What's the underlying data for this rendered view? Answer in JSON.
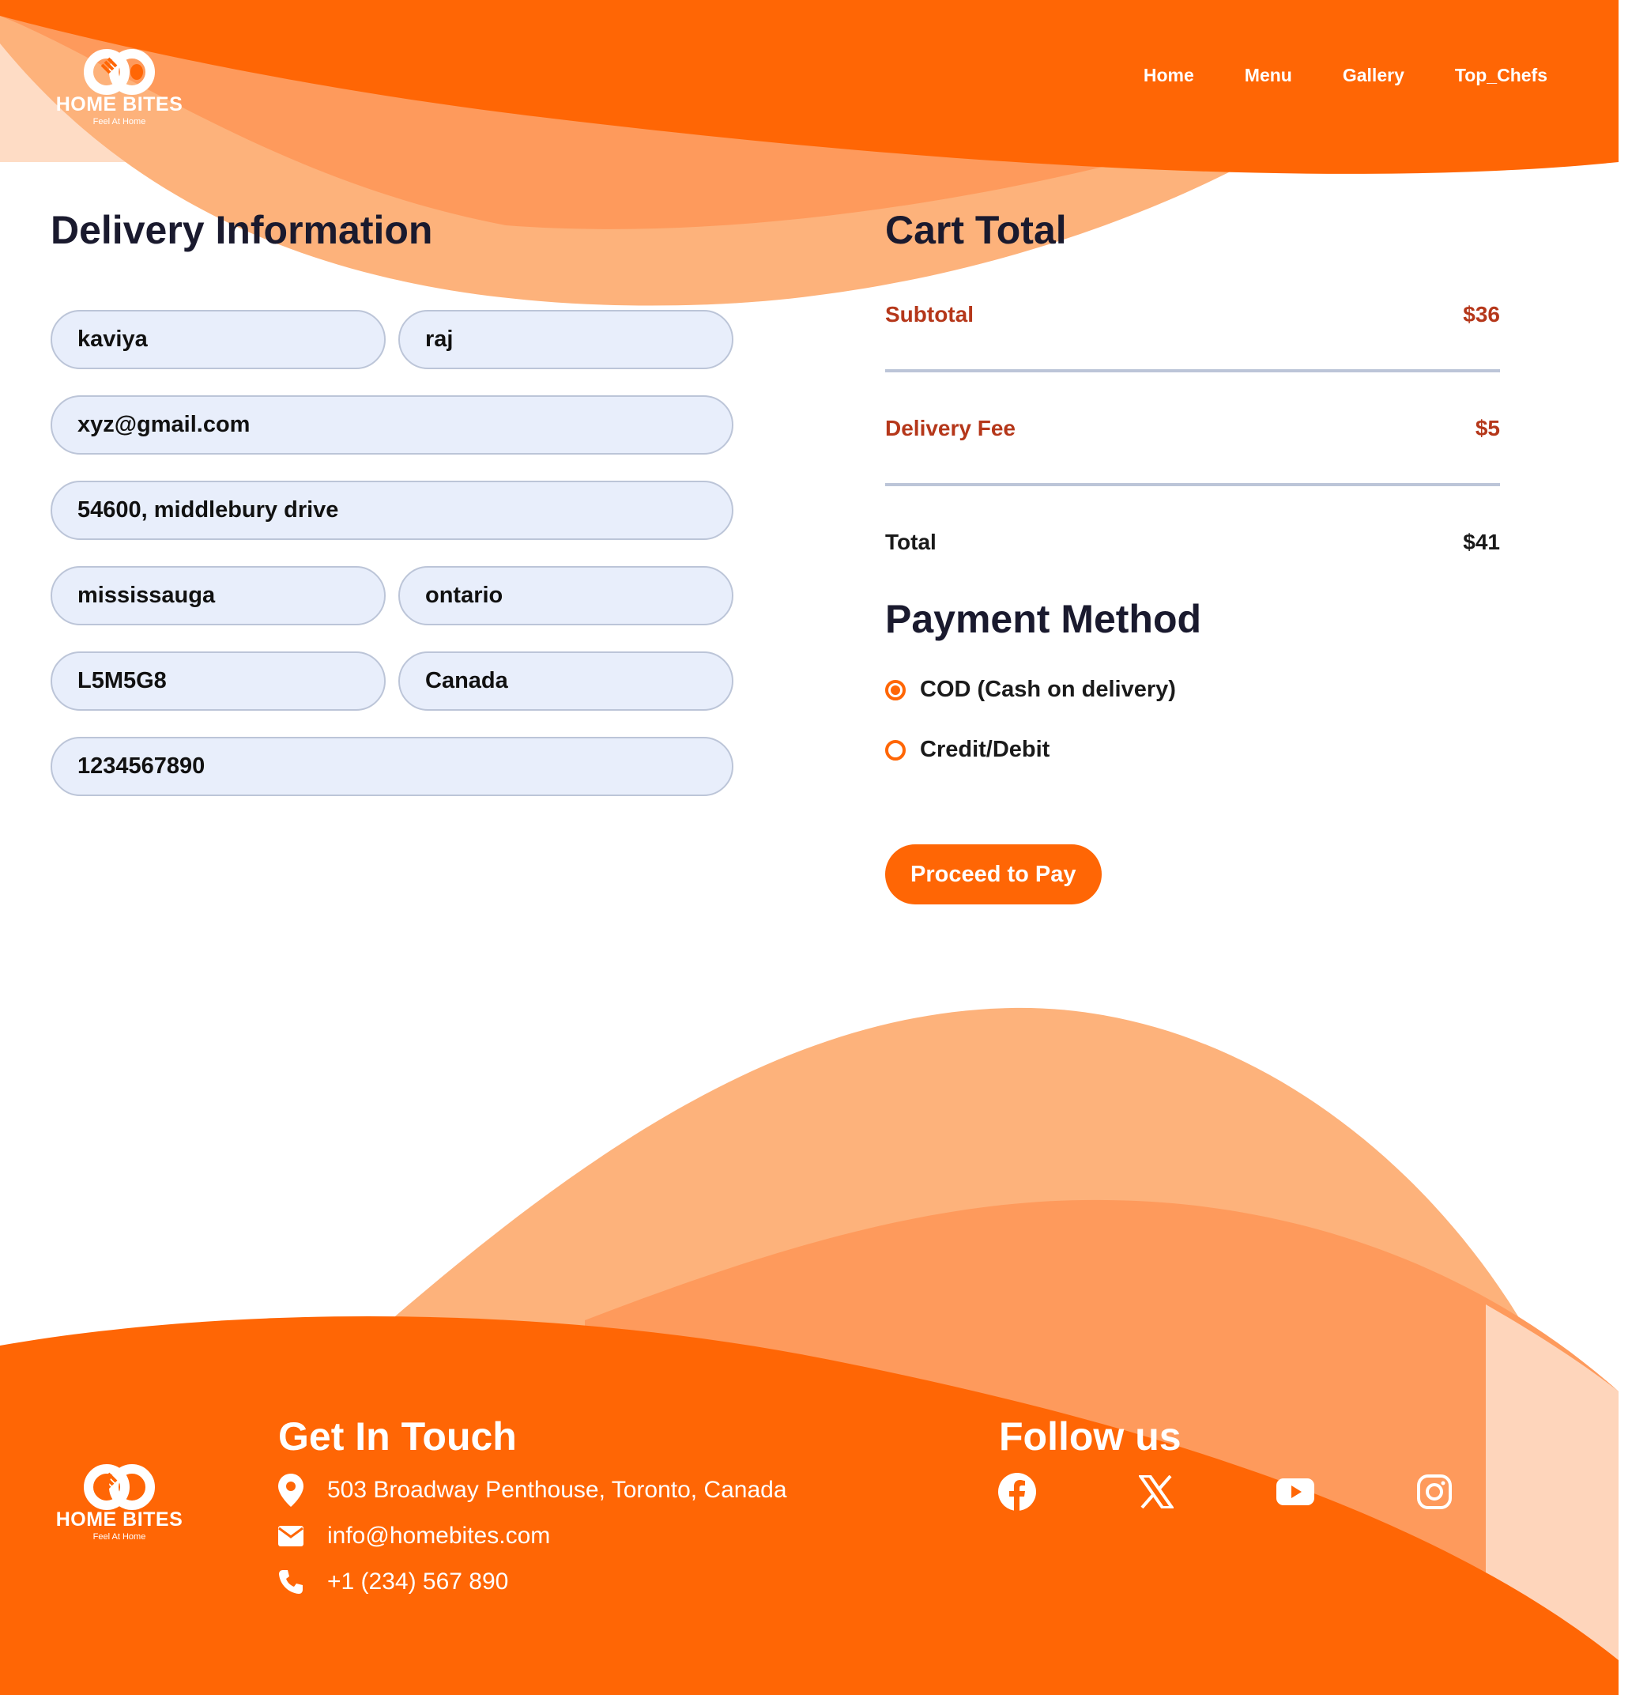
{
  "brand": {
    "name": "HOME BITES",
    "tagline": "Feel At Home"
  },
  "nav": {
    "items": [
      "Home",
      "Menu",
      "Gallery",
      "Top_Chefs"
    ]
  },
  "delivery": {
    "title": "Delivery Information",
    "first_name": "kaviya",
    "last_name": "raj",
    "email": "xyz@gmail.com",
    "street": "54600, middlebury drive",
    "city": "mississauga",
    "state": "ontario",
    "zip": "L5M5G8",
    "country": "Canada",
    "phone": "1234567890"
  },
  "cart": {
    "title": "Cart Total",
    "subtotal_label": "Subtotal",
    "subtotal_value": "$36",
    "fee_label": "Delivery Fee",
    "fee_value": "$5",
    "total_label": "Total",
    "total_value": "$41"
  },
  "payment": {
    "title": "Payment Method",
    "options": [
      {
        "label": "COD (Cash on delivery)",
        "selected": true
      },
      {
        "label": "Credit/Debit",
        "selected": false
      }
    ],
    "button_label": "Proceed to Pay"
  },
  "footer": {
    "contact_title": "Get In Touch",
    "address": "503 Broadway Penthouse, Toronto, Canada",
    "email": "info@homebites.com",
    "phone": "+1 (234) 567 890",
    "follow_title": "Follow us",
    "socials": [
      "facebook-icon",
      "x-icon",
      "youtube-icon",
      "instagram-icon"
    ]
  },
  "colors": {
    "accent": "#ff6605",
    "accent_light": "#fdb27b",
    "accent_mid": "#fe9a5c",
    "accent_pale": "#fedcc5",
    "label_red": "#b5371a",
    "input_bg": "#e8eefb",
    "input_border": "#bcc5d8",
    "heading": "#1a1a2e"
  }
}
